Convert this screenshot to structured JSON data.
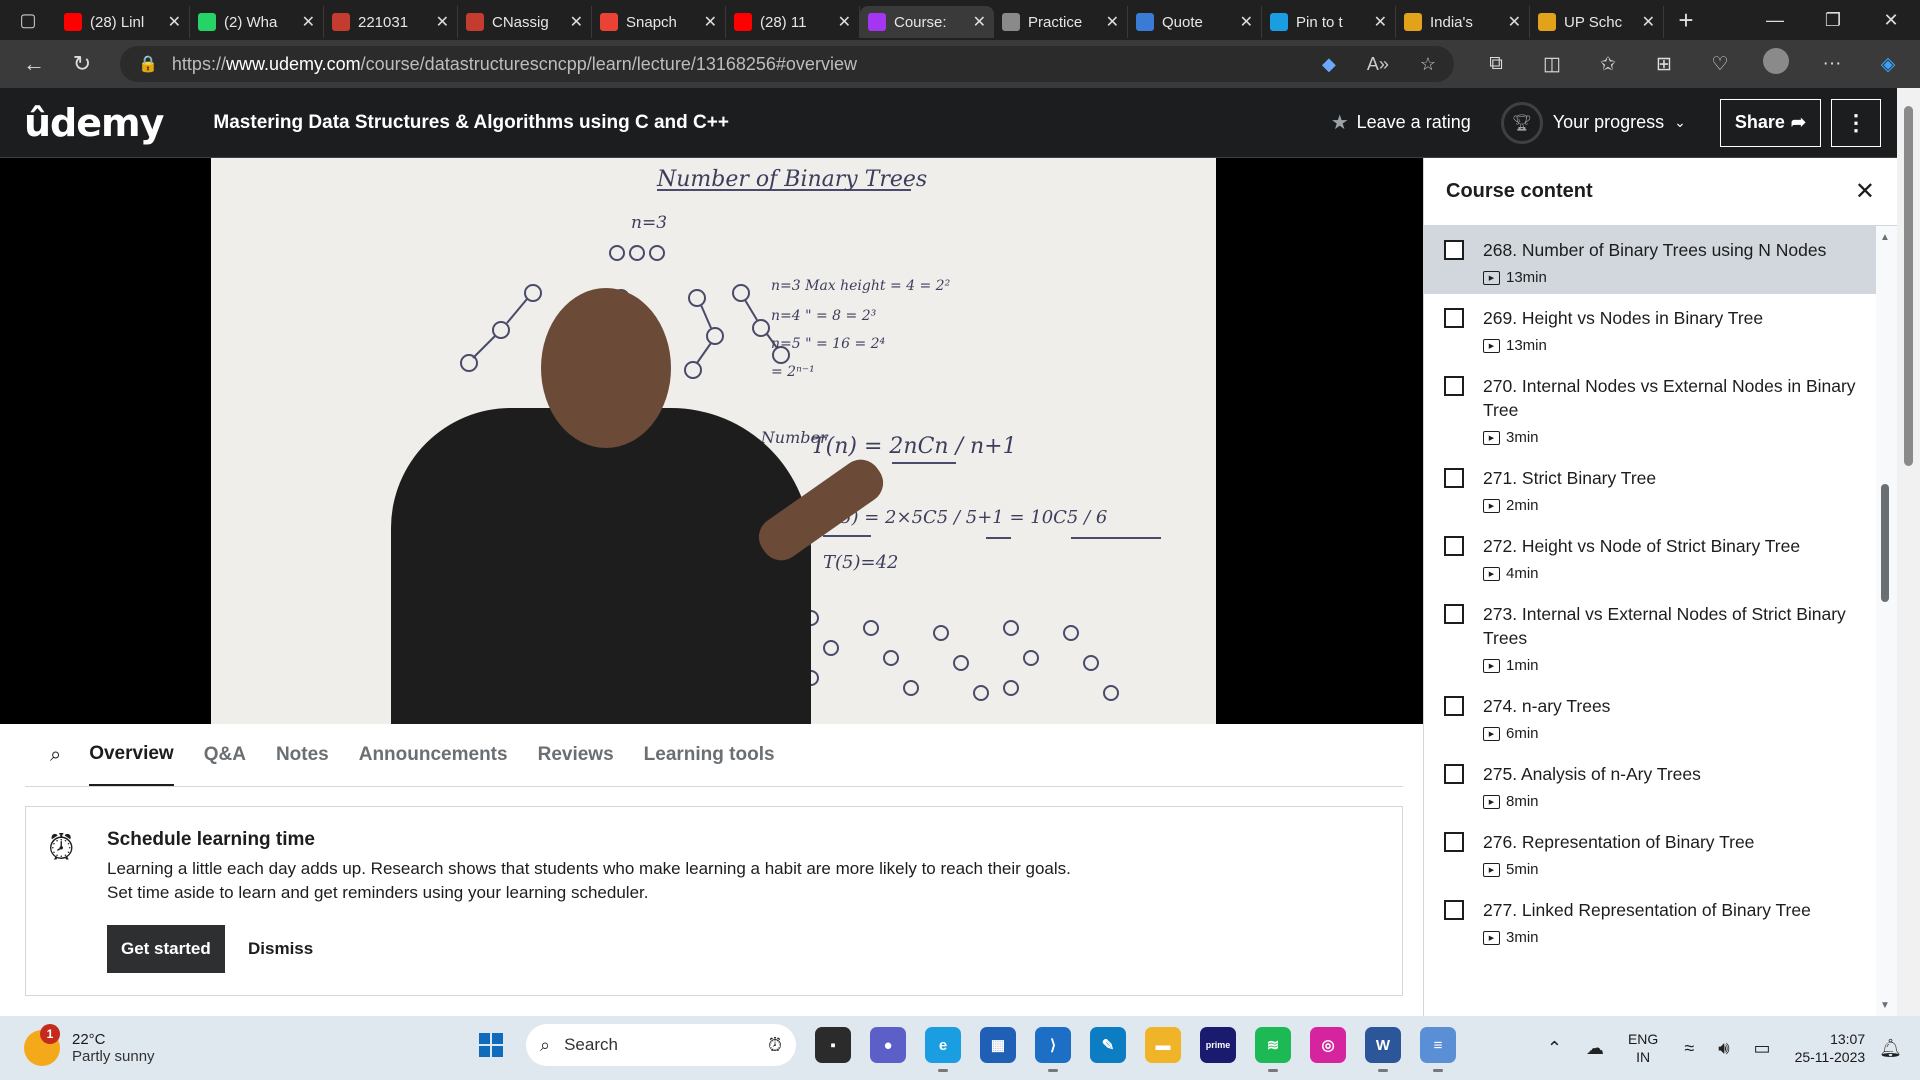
{
  "browser": {
    "tabs": [
      {
        "label": "(28) Linl",
        "icon": "youtube-icon",
        "color": "#ff0000"
      },
      {
        "label": "(2) Wha",
        "icon": "whatsapp-icon",
        "color": "#25d366"
      },
      {
        "label": "221031",
        "icon": "pdf-icon",
        "color": "#c43b2f"
      },
      {
        "label": "CNassig",
        "icon": "pdf-icon",
        "color": "#c43b2f"
      },
      {
        "label": "Snapch",
        "icon": "gmail-icon",
        "color": "#ea4335"
      },
      {
        "label": "(28) 11",
        "icon": "youtube-icon",
        "color": "#ff0000"
      },
      {
        "label": "Course:",
        "icon": "udemy-icon",
        "color": "#a435f0"
      },
      {
        "label": "Practice",
        "icon": "page-icon",
        "color": "#8a8a8a"
      },
      {
        "label": "Quote",
        "icon": "search-icon",
        "color": "#3a7bd5"
      },
      {
        "label": "Pin to t",
        "icon": "edge-icon",
        "color": "#1b9de2"
      },
      {
        "label": "India's",
        "icon": "bookmark-icon",
        "color": "#e2a31b"
      },
      {
        "label": "UP Schc",
        "icon": "bookmark-icon",
        "color": "#e2a31b"
      }
    ],
    "active_tab_index": 6,
    "url_host": "www.udemy.com",
    "url_prefix": "https://",
    "url_path": "/course/datastructurescncpp/learn/lecture/13168256#overview"
  },
  "header": {
    "logo": "ûdemy",
    "course_title": "Mastering Data Structures & Algorithms using C and C++",
    "rating_label": "Leave a rating",
    "progress_label": "Your progress",
    "share_label": "Share"
  },
  "lecture_tabs": [
    "Overview",
    "Q&A",
    "Notes",
    "Announcements",
    "Reviews",
    "Learning tools"
  ],
  "active_lecture_tab": "Overview",
  "schedule": {
    "title": "Schedule learning time",
    "line1": "Learning a little each day adds up. Research shows that students who make learning a habit are more likely to reach their goals.",
    "line2": "Set time aside to learn and get reminders using your learning scheduler.",
    "primary_button": "Get started",
    "secondary_button": "Dismiss"
  },
  "sidebar": {
    "title": "Course content",
    "lessons": [
      {
        "name": "268. Number of Binary Trees using N Nodes",
        "duration": "13min",
        "current": true
      },
      {
        "name": "269. Height vs Nodes in Binary Tree",
        "duration": "13min",
        "current": false
      },
      {
        "name": "270. Internal Nodes vs External Nodes in Binary Tree",
        "duration": "3min",
        "current": false
      },
      {
        "name": "271. Strict Binary Tree",
        "duration": "2min",
        "current": false
      },
      {
        "name": "272. Height vs Node of Strict Binary Tree",
        "duration": "4min",
        "current": false
      },
      {
        "name": "273. Internal vs External Nodes of Strict Binary Trees",
        "duration": "1min",
        "current": false
      },
      {
        "name": "274. n-ary Trees",
        "duration": "6min",
        "current": false
      },
      {
        "name": "275. Analysis of n-Ary Trees",
        "duration": "8min",
        "current": false
      },
      {
        "name": "276. Representation of Binary Tree",
        "duration": "5min",
        "current": false
      },
      {
        "name": "277. Linked Representation of Binary Tree",
        "duration": "3min",
        "current": false
      }
    ]
  },
  "whiteboard": {
    "title": "Number of Binary Trees",
    "n_label": "n=3",
    "height_rows": [
      "n=3   Max height = 4 = 2²",
      "n=4      \"     = 8 = 2³",
      "n=5      \"     = 16 = 2⁴",
      "              = 2ⁿ⁻¹"
    ],
    "catalan_label": "Catalan Number",
    "formula": "T(n) = 2nCn / n+1",
    "example": "T(5) = 2×5C5 / 5+1 = 10C5 / 6",
    "result": "T(5)=42"
  },
  "taskbar": {
    "weather_temp": "22°C",
    "weather_cond": "Partly sunny",
    "weather_badge": "1",
    "search_placeholder": "Search",
    "lang_top": "ENG",
    "lang_bottom": "IN",
    "time": "13:07",
    "date": "25-11-2023"
  },
  "colors": {
    "udemy_dark": "#1c1d1f",
    "udemy_purple": "#a435f0",
    "current_lesson_bg": "#d1d7dc"
  }
}
